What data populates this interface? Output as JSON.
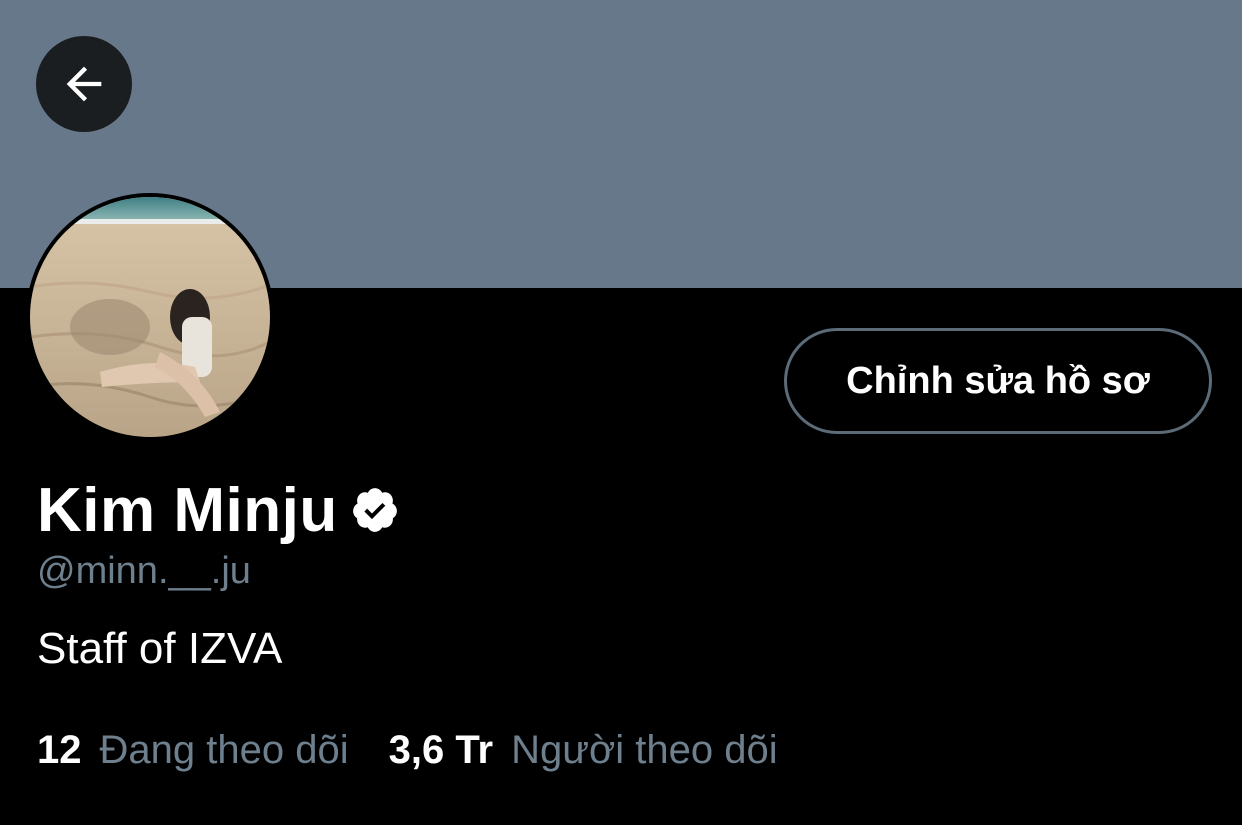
{
  "profile": {
    "display_name": "Kim Minju",
    "handle": "@minn.__.ju",
    "bio": "Staff of IZVA",
    "verified": true
  },
  "actions": {
    "back_icon": "arrow-left-icon",
    "edit_profile_label": "Chỉnh sửa hồ sơ"
  },
  "stats": {
    "following_count": "12",
    "following_label": "Đang theo dõi",
    "followers_count": "3,6 Tr",
    "followers_label": "Người theo dõi"
  },
  "colors": {
    "banner": "#66788a",
    "background": "#000000",
    "secondary_text": "#6e7f8d",
    "button_border": "#5b6b78"
  }
}
